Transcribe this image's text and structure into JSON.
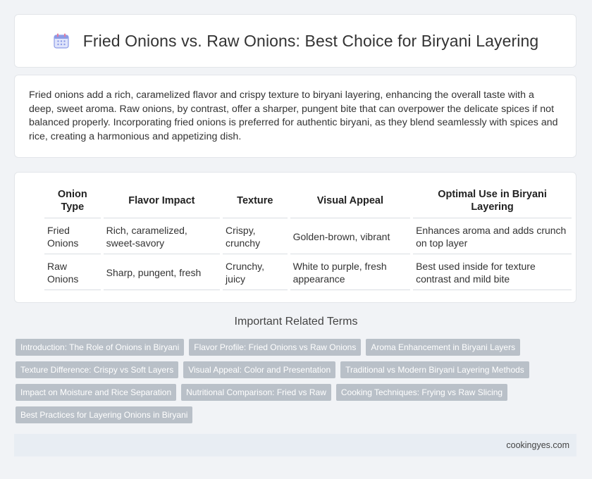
{
  "header": {
    "title": "Fried Onions vs. Raw Onions: Best Choice for Biryani Layering",
    "icon": "calendar-icon",
    "icon_color": "#6a7fd8"
  },
  "intro": {
    "text": "Fried onions add a rich, caramelized flavor and crispy texture to biryani layering, enhancing the overall taste with a deep, sweet aroma. Raw onions, by contrast, offer a sharper, pungent bite that can overpower the delicate spices if not balanced properly. Incorporating fried onions is preferred for authentic biryani, as they blend seamlessly with spices and rice, creating a harmonious and appetizing dish."
  },
  "table": {
    "headers": [
      "Onion Type",
      "Flavor Impact",
      "Texture",
      "Visual Appeal",
      "Optimal Use in Biryani Layering"
    ],
    "rows": [
      [
        "Fried Onions",
        "Rich, caramelized, sweet-savory",
        "Crispy, crunchy",
        "Golden-brown, vibrant",
        "Enhances aroma and adds crunch on top layer"
      ],
      [
        "Raw Onions",
        "Sharp, pungent, fresh",
        "Crunchy, juicy",
        "White to purple, fresh appearance",
        "Best used inside for texture contrast and mild bite"
      ]
    ]
  },
  "related": {
    "title": "Important Related Terms",
    "chips": [
      "Introduction: The Role of Onions in Biryani",
      "Flavor Profile: Fried Onions vs Raw Onions",
      "Aroma Enhancement in Biryani Layers",
      "Texture Difference: Crispy vs Soft Layers",
      "Visual Appeal: Color and Presentation",
      "Traditional vs Modern Biryani Layering Methods",
      "Impact on Moisture and Rice Separation",
      "Nutritional Comparison: Fried vs Raw",
      "Cooking Techniques: Frying vs Raw Slicing",
      "Best Practices for Layering Onions in Biryani"
    ],
    "chip_color": "#b9c0c8"
  },
  "footer": {
    "site": "cookingyes.com"
  }
}
